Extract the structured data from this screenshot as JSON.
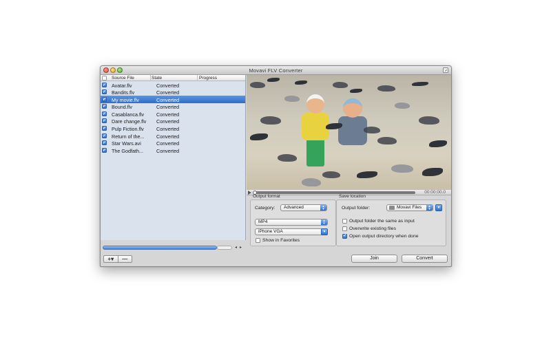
{
  "window": {
    "title": "Movavi  FLV  Converter"
  },
  "list": {
    "headers": {
      "source": "Source File",
      "state": "State",
      "progress": "Progress"
    },
    "rows": [
      {
        "name": "Avatar.flv",
        "state": "Converted"
      },
      {
        "name": "Bandits.flv",
        "state": "Converted"
      },
      {
        "name": "My movie.flv",
        "state": "Converted"
      },
      {
        "name": "Bound.flv",
        "state": "Converted"
      },
      {
        "name": "Casablanca.flv",
        "state": "Converted"
      },
      {
        "name": "Dare change.flv",
        "state": "Converted"
      },
      {
        "name": "Pulp Fiction.flv",
        "state": "Converted"
      },
      {
        "name": "Return of the...",
        "state": "Converted"
      },
      {
        "name": "Star Wars.avi",
        "state": "Converted"
      },
      {
        "name": "The Godfath...",
        "state": "Converted"
      }
    ],
    "selected_index": 2,
    "add_label": "+▾",
    "remove_label": "—"
  },
  "player": {
    "timecode": "00:00:00.0"
  },
  "output_format": {
    "title": "Output format",
    "category_label": "Category:",
    "category_value": "Advanced",
    "format_value": "MP4",
    "preset_value": "iPhone VGA",
    "favorites_label": "Show in Favorites"
  },
  "save_location": {
    "title": "Save location",
    "folder_label": "Output folder:",
    "folder_value": "Movavi Files",
    "opt_same_as_input": "Output folder the same as input",
    "opt_overwrite": "Overwrite existing files",
    "opt_open_when_done": "Open output directory when done"
  },
  "buttons": {
    "join": "Join",
    "convert": "Convert"
  }
}
